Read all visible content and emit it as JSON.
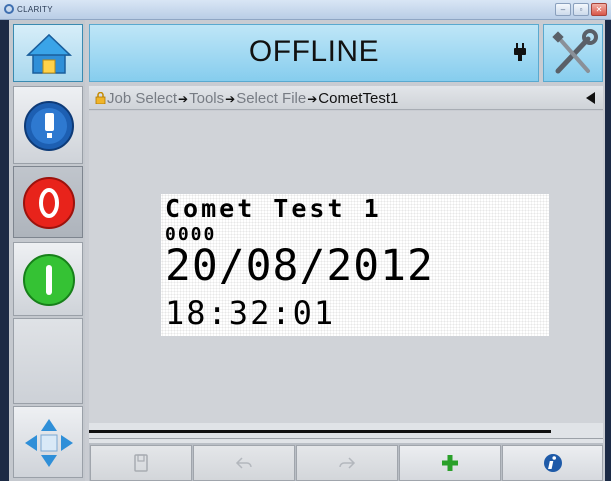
{
  "window": {
    "title": "CLARITY"
  },
  "header": {
    "status": "OFFLINE"
  },
  "breadcrumb": {
    "items": [
      "Job Select",
      "Tools",
      "Select File"
    ],
    "separator": "➔",
    "current": "CometTest1"
  },
  "label_preview": {
    "line1": "Comet Test 1",
    "line2": "0000",
    "line3": "20/08/2012",
    "line4": "18:32:01"
  },
  "colors": {
    "status_bg": "#86cdee",
    "stop_red": "#e8231b",
    "start_green": "#35c234",
    "info_blue": "#1e5aa8",
    "add_green": "#2aa02a"
  },
  "icons": {
    "home": "home-icon",
    "tools": "wrench-screwdriver-icon",
    "connection": "plug-icon",
    "status": "info-ink-icon",
    "stop": "stop-icon",
    "start": "start-icon",
    "navigate": "directional-arrows-icon",
    "save": "save-icon",
    "undo": "undo-icon",
    "redo": "redo-icon",
    "add": "add-icon",
    "info": "info-icon"
  }
}
